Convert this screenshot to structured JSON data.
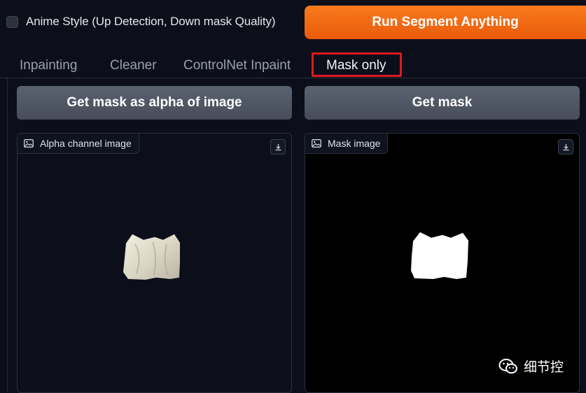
{
  "options": {
    "anime_style_label": "Anime Style (Up Detection, Down mask Quality)",
    "anime_style_checked": false
  },
  "run_button": {
    "label": "Run Segment Anything"
  },
  "tabs": [
    {
      "label": "Inpainting",
      "active": false
    },
    {
      "label": "Cleaner",
      "active": false
    },
    {
      "label": "ControlNet Inpaint",
      "active": false
    },
    {
      "label": "Mask only",
      "active": true
    }
  ],
  "mask_only": {
    "alpha_button_label": "Get mask as alpha of image",
    "mask_button_label": "Get mask",
    "alpha_panel": {
      "label": "Alpha channel image",
      "icon": "image-icon",
      "download_icon": "download-icon"
    },
    "mask_panel": {
      "label": "Mask image",
      "icon": "image-icon",
      "download_icon": "download-icon"
    }
  },
  "watermark": {
    "text": "细节控",
    "icon": "wechat-icon"
  },
  "colors": {
    "accent_orange": "#f36c16",
    "highlight_red": "#e0181e",
    "background": "#0c0f1a",
    "button_gray": "#4f5563"
  }
}
